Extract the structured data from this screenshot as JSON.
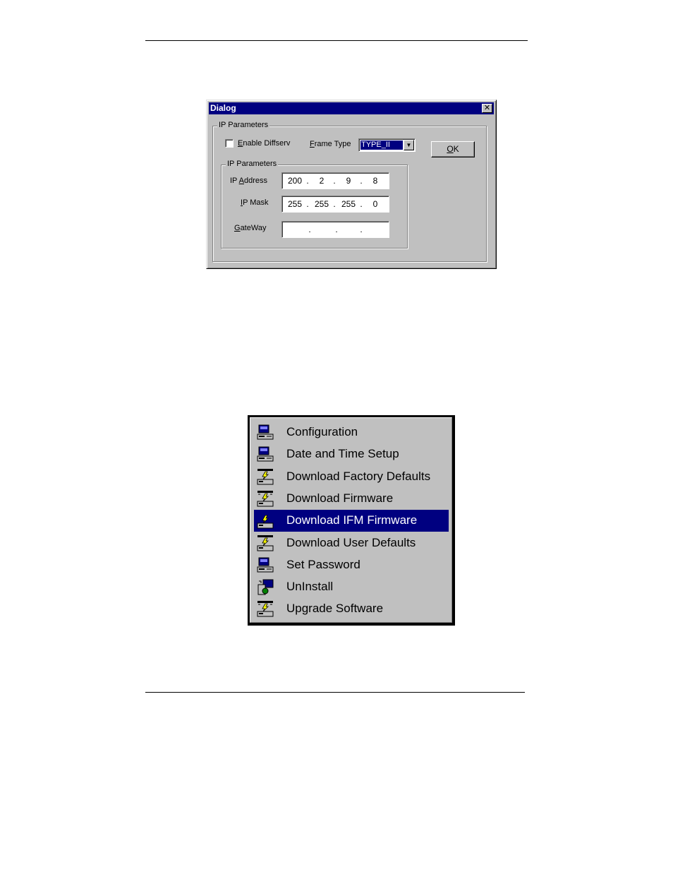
{
  "dialog": {
    "title": "Dialog",
    "close_label": "✕",
    "outer_group_label": "IP Parameters",
    "enable_diffserv": {
      "label_accel": "E",
      "label_rest": "nable Diffserv",
      "checked": false
    },
    "frame_type": {
      "label_accel": "F",
      "label_rest": "rame Type",
      "value": "TYPE_II",
      "arrow": "▼"
    },
    "ok_button": {
      "accel": "O",
      "rest": "K"
    },
    "inner_group_label": "IP Parameters",
    "ip_address": {
      "label_pre": "IP ",
      "label_accel": "A",
      "label_rest": "ddress",
      "octets": [
        "200",
        "2",
        "9",
        "8"
      ]
    },
    "ip_mask": {
      "label_pre": "",
      "label_accel": "I",
      "label_rest": "P Mask",
      "octets": [
        "255",
        "255",
        "255",
        "0"
      ]
    },
    "gateway": {
      "label_pre": "",
      "label_accel": "G",
      "label_rest": "ateWay",
      "octets": [
        "",
        "",
        "",
        ""
      ]
    },
    "dot": "."
  },
  "menu": {
    "selected_index": 4,
    "items": [
      {
        "label": "Configuration",
        "icon": "computer-icon"
      },
      {
        "label": "Date and Time Setup",
        "icon": "computer-icon"
      },
      {
        "label": "Download Factory Defaults",
        "icon": "download-default-icon"
      },
      {
        "label": "Download Firmware",
        "icon": "download-firmware-icon"
      },
      {
        "label": "Download IFM Firmware",
        "icon": "download-ifm-icon"
      },
      {
        "label": "Download User Defaults",
        "icon": "download-default-icon"
      },
      {
        "label": "Set Password",
        "icon": "computer-icon"
      },
      {
        "label": "UnInstall",
        "icon": "uninstall-icon"
      },
      {
        "label": "Upgrade Software",
        "icon": "download-firmware-icon"
      }
    ]
  },
  "colors": {
    "selection": "#000080",
    "face": "#c0c0c0",
    "titlebar": "#000080"
  }
}
